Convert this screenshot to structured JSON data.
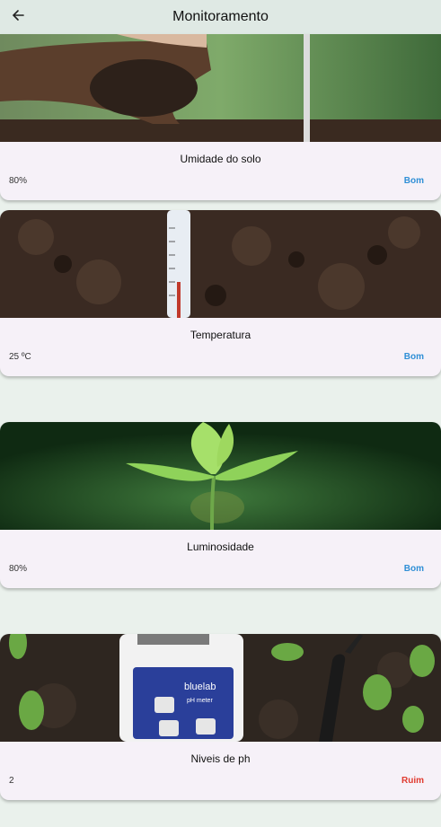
{
  "header": {
    "title": "Monitoramento",
    "back_icon": "arrow-left-icon"
  },
  "colors": {
    "good": "#2f8fd6",
    "bad": "#e03a2f"
  },
  "cards": [
    {
      "name": "Umidade do solo",
      "value": "80%",
      "status": "Bom",
      "status_kind": "good",
      "image": "hand-holding-soil"
    },
    {
      "name": "Temperatura",
      "value": "25 ºC",
      "status": "Bom",
      "status_kind": "good",
      "image": "thermometer-in-soil"
    },
    {
      "name": "Luminosidade",
      "value": "80%",
      "status": "Bom",
      "status_kind": "good",
      "image": "seedling-sprout"
    },
    {
      "name": "Niveis de ph",
      "value": "2",
      "status": "Ruim",
      "status_kind": "bad",
      "image": "ph-meter-bluelab",
      "image_text": {
        "brand": "bluelab",
        "product": "pH meter"
      }
    }
  ]
}
